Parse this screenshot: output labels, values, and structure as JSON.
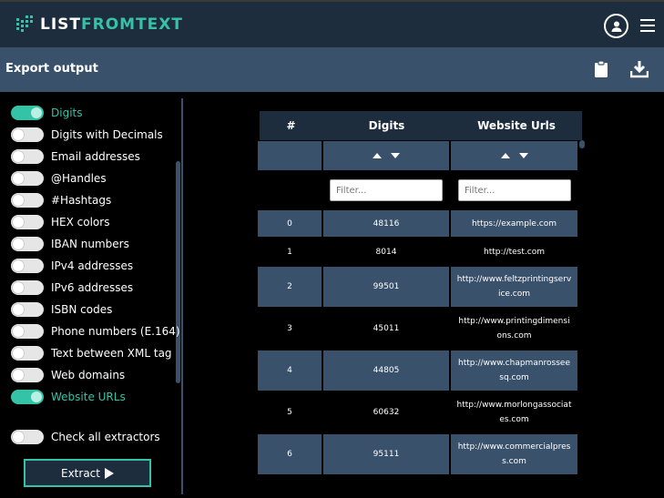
{
  "app": {
    "logo_part1": "LIST",
    "logo_part2": "FROMTEXT",
    "accent": "#34c3a6",
    "topbar_color": "#1d2d3d",
    "band_color": "#3a516b"
  },
  "subbar": {
    "title": "Export output"
  },
  "extractors": [
    {
      "label": "Digits",
      "on": true
    },
    {
      "label": "Digits with Decimals",
      "on": false
    },
    {
      "label": "Email addresses",
      "on": false
    },
    {
      "label": "@Handles",
      "on": false
    },
    {
      "label": "#Hashtags",
      "on": false
    },
    {
      "label": "HEX colors",
      "on": false
    },
    {
      "label": "IBAN numbers",
      "on": false
    },
    {
      "label": "IPv4 addresses",
      "on": false
    },
    {
      "label": "IPv6 addresses",
      "on": false
    },
    {
      "label": "ISBN codes",
      "on": false
    },
    {
      "label": "Phone numbers (E.164)",
      "on": false
    },
    {
      "label": "Text between XML tag",
      "on": false
    },
    {
      "label": "Web domains",
      "on": false
    },
    {
      "label": "Website URLs",
      "on": true
    }
  ],
  "check_all": {
    "label": "Check all extractors",
    "on": false
  },
  "extract_button": "Extract",
  "table": {
    "columns": [
      "#",
      "Digits",
      "Website Urls"
    ],
    "filter_placeholder": "Filter...",
    "rows": [
      {
        "index": "0",
        "digits": "48116",
        "url": "https://example.com"
      },
      {
        "index": "1",
        "digits": "8014",
        "url": "http://test.com"
      },
      {
        "index": "2",
        "digits": "99501",
        "url": "http://www.feltzprintingservice.com"
      },
      {
        "index": "3",
        "digits": "45011",
        "url": "http://www.printingdimensions.com"
      },
      {
        "index": "4",
        "digits": "44805",
        "url": "http://www.chapmanrosseesq.com"
      },
      {
        "index": "5",
        "digits": "60632",
        "url": "http://www.morlongassociates.com"
      },
      {
        "index": "6",
        "digits": "95111",
        "url": "http://www.commercialpress.com"
      }
    ]
  }
}
